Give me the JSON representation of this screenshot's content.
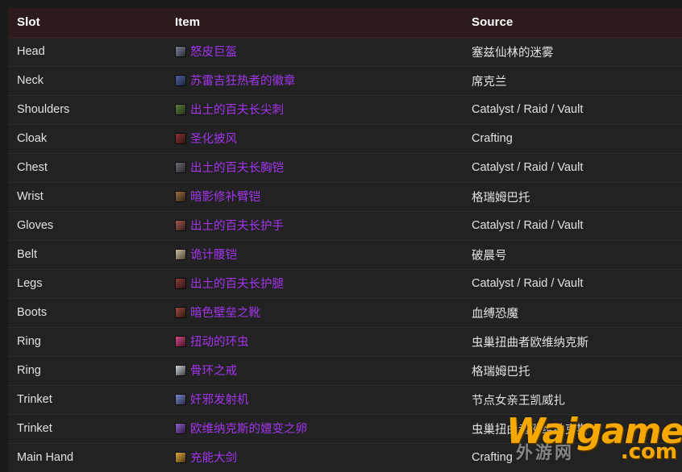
{
  "table": {
    "columns": [
      "Slot",
      "Item",
      "Source"
    ],
    "rows": [
      {
        "slot": "Head",
        "item": "怒皮巨盔",
        "item_quality_color": "#a335ee",
        "icon": "helm-icon",
        "icon_colors": [
          "#7a7f8c",
          "#2b2f38"
        ],
        "source": "塞兹仙林的迷雾",
        "source_style": "gold"
      },
      {
        "slot": "Neck",
        "item": "苏雷吉狂热者的徽章",
        "item_quality_color": "#a335ee",
        "icon": "amulet-icon",
        "icon_colors": [
          "#4a5f9e",
          "#1d2640"
        ],
        "source": "席克兰",
        "source_style": "gold"
      },
      {
        "slot": "Shoulders",
        "item": "出土的百夫长尖刺",
        "item_quality_color": "#a335ee",
        "icon": "shoulder-icon",
        "icon_colors": [
          "#5f7a3a",
          "#23301a"
        ],
        "source": "Catalyst / Raid / Vault",
        "source_style": "plain"
      },
      {
        "slot": "Cloak",
        "item": "圣化披风",
        "item_quality_color": "#a335ee",
        "icon": "cloak-icon",
        "icon_colors": [
          "#8c3430",
          "#2e1312"
        ],
        "source": "Crafting",
        "source_style": "plain"
      },
      {
        "slot": "Chest",
        "item": "出土的百夫长胸铠",
        "item_quality_color": "#a335ee",
        "icon": "chest-icon",
        "icon_colors": [
          "#6e6e78",
          "#26262c"
        ],
        "source": "Catalyst / Raid / Vault",
        "source_style": "plain"
      },
      {
        "slot": "Wrist",
        "item": "暗影修补臂铠",
        "item_quality_color": "#a335ee",
        "icon": "bracer-icon",
        "icon_colors": [
          "#9a6f44",
          "#2f2115"
        ],
        "source": "格瑞姆巴托",
        "source_style": "gold"
      },
      {
        "slot": "Gloves",
        "item": "出土的百夫长护手",
        "item_quality_color": "#a335ee",
        "icon": "gloves-icon",
        "icon_colors": [
          "#a5594a",
          "#33201c"
        ],
        "source": "Catalyst / Raid / Vault",
        "source_style": "plain"
      },
      {
        "slot": "Belt",
        "item": "诡计腰铠",
        "item_quality_color": "#a335ee",
        "icon": "belt-icon",
        "icon_colors": [
          "#cbbfa0",
          "#4a4334"
        ],
        "source": "破晨号",
        "source_style": "gold"
      },
      {
        "slot": "Legs",
        "item": "出土的百夫长护腿",
        "item_quality_color": "#a335ee",
        "icon": "legs-icon",
        "icon_colors": [
          "#8e3d3a",
          "#2c1414"
        ],
        "source": "Catalyst / Raid / Vault",
        "source_style": "plain"
      },
      {
        "slot": "Boots",
        "item": "暗色壁垒之靴",
        "item_quality_color": "#a335ee",
        "icon": "boots-icon",
        "icon_colors": [
          "#9d4a3e",
          "#301715"
        ],
        "source": "血缚恐魔",
        "source_style": "gold"
      },
      {
        "slot": "Ring",
        "item": "扭动的环虫",
        "item_quality_color": "#a335ee",
        "icon": "ring-worm-icon",
        "icon_colors": [
          "#d44a86",
          "#46122a"
        ],
        "source": "虫巢扭曲者欧维纳克斯",
        "source_style": "gold"
      },
      {
        "slot": "Ring",
        "item": "骨环之戒",
        "item_quality_color": "#a335ee",
        "icon": "bone-ring-icon",
        "icon_colors": [
          "#cfd2d6",
          "#3a3d42"
        ],
        "source": "格瑞姆巴托",
        "source_style": "gold"
      },
      {
        "slot": "Trinket",
        "item": "奸邪发射机",
        "item_quality_color": "#a335ee",
        "icon": "trinket-icon",
        "icon_colors": [
          "#7b86c9",
          "#272b47"
        ],
        "source": "节点女亲王凯威扎",
        "source_style": "gold"
      },
      {
        "slot": "Trinket",
        "item": "欧维纳克斯的嬗变之卵",
        "item_quality_color": "#a335ee",
        "icon": "egg-icon",
        "icon_colors": [
          "#8e5fc9",
          "#2b1a40"
        ],
        "source": "虫巢扭曲者欧维纳克斯",
        "source_style": "gold"
      },
      {
        "slot": "Main Hand",
        "item": "充能大剑",
        "item_quality_color": "#a335ee",
        "icon": "sword-icon",
        "icon_colors": [
          "#e0a63c",
          "#4a3413"
        ],
        "source": "Crafting",
        "source_style": "plain"
      }
    ]
  },
  "watermark": {
    "main_text": "Waigamer",
    "domain_text": ".com",
    "cn_text": "外游网",
    "color": "#f5a800"
  },
  "colors": {
    "page_background": "#1b1b1b",
    "header_background": "#2d1a1c",
    "row_background": "#222222",
    "row_divider": "#2e2e2e",
    "header_text": "#ffffff",
    "slot_text": "#e6e6e6",
    "item_link": "#a335ee",
    "source_gold": "#ffd100",
    "source_plain": "#e2e2e2"
  }
}
